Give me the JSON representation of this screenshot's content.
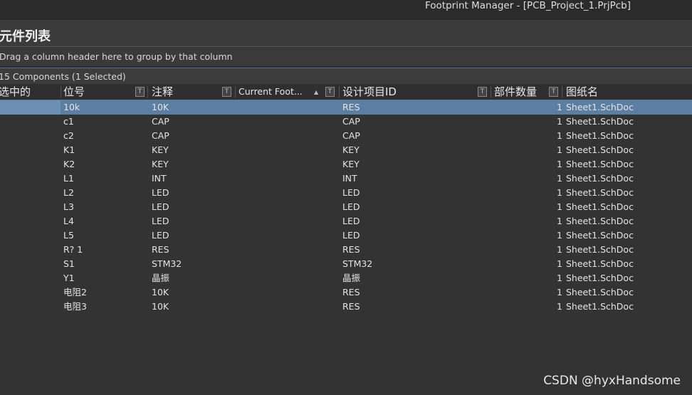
{
  "window": {
    "title": "Footprint Manager - [PCB_Project_1.PrjPcb]"
  },
  "panel": {
    "title": "元件列表"
  },
  "group_bar": {
    "text": "Drag a column header here to group by that column"
  },
  "count_bar": {
    "text": "15 Components (1 Selected)"
  },
  "columns": {
    "selected": "选中的",
    "designator": "位号",
    "comment": "注释",
    "current_footprint": "Current Foot...",
    "design_item_id": "设计项目ID",
    "part_count": "部件数量",
    "sheet_name": "图纸名"
  },
  "rows": [
    {
      "designator": "10k",
      "comment": "10K",
      "design_item_id": "RES",
      "part_count": "1",
      "sheet": "Sheet1.SchDoc",
      "selected": true
    },
    {
      "designator": "c1",
      "comment": "CAP",
      "design_item_id": "CAP",
      "part_count": "1",
      "sheet": "Sheet1.SchDoc",
      "selected": false
    },
    {
      "designator": "c2",
      "comment": "CAP",
      "design_item_id": "CAP",
      "part_count": "1",
      "sheet": "Sheet1.SchDoc",
      "selected": false
    },
    {
      "designator": "K1",
      "comment": "KEY",
      "design_item_id": "KEY",
      "part_count": "1",
      "sheet": "Sheet1.SchDoc",
      "selected": false
    },
    {
      "designator": "K2",
      "comment": "KEY",
      "design_item_id": "KEY",
      "part_count": "1",
      "sheet": "Sheet1.SchDoc",
      "selected": false
    },
    {
      "designator": "L1",
      "comment": "INT",
      "design_item_id": "INT",
      "part_count": "1",
      "sheet": "Sheet1.SchDoc",
      "selected": false
    },
    {
      "designator": "L2",
      "comment": "LED",
      "design_item_id": "LED",
      "part_count": "1",
      "sheet": "Sheet1.SchDoc",
      "selected": false
    },
    {
      "designator": "L3",
      "comment": "LED",
      "design_item_id": "LED",
      "part_count": "1",
      "sheet": "Sheet1.SchDoc",
      "selected": false
    },
    {
      "designator": "L4",
      "comment": "LED",
      "design_item_id": "LED",
      "part_count": "1",
      "sheet": "Sheet1.SchDoc",
      "selected": false
    },
    {
      "designator": "L5",
      "comment": "LED",
      "design_item_id": "LED",
      "part_count": "1",
      "sheet": "Sheet1.SchDoc",
      "selected": false
    },
    {
      "designator": "R? 1",
      "comment": "RES",
      "design_item_id": "RES",
      "part_count": "1",
      "sheet": "Sheet1.SchDoc",
      "selected": false
    },
    {
      "designator": "S1",
      "comment": "STM32",
      "design_item_id": "STM32",
      "part_count": "1",
      "sheet": "Sheet1.SchDoc",
      "selected": false
    },
    {
      "designator": "Y1",
      "comment": "晶振",
      "design_item_id": "晶振",
      "part_count": "1",
      "sheet": "Sheet1.SchDoc",
      "selected": false
    },
    {
      "designator": "电阻2",
      "comment": "10K",
      "design_item_id": "RES",
      "part_count": "1",
      "sheet": "Sheet1.SchDoc",
      "selected": false
    },
    {
      "designator": "电阻3",
      "comment": "10K",
      "design_item_id": "RES",
      "part_count": "1",
      "sheet": "Sheet1.SchDoc",
      "selected": false
    }
  ],
  "icons": {
    "filter": "filter-icon",
    "sort": "sort-ascending-icon"
  },
  "watermark": {
    "text": "CSDN @hyxHandsome"
  },
  "colors": {
    "background": "#333333",
    "selection": "#5b7ea3",
    "header_border": "#5a7da0"
  }
}
